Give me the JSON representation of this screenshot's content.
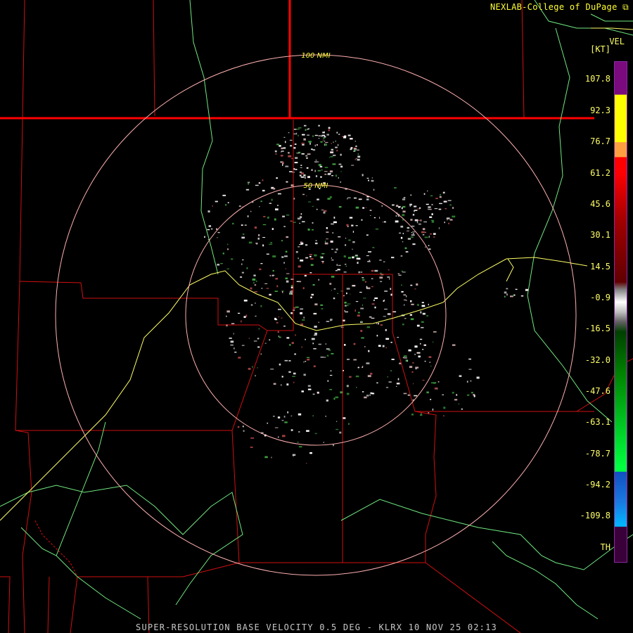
{
  "header": {
    "credit": "NEXLAB-College of DuPage",
    "credit_icon": "external-link-icon",
    "product_code": "VEL",
    "units": "[KT]"
  },
  "rings": [
    {
      "label": "100 NMI"
    },
    {
      "label": "50 NMI"
    }
  ],
  "legend": {
    "labels": [
      "107.8",
      "92.3",
      "76.7",
      "61.2",
      "45.6",
      "30.1",
      "14.5",
      "-0.9",
      "-16.5",
      "-32.0",
      "-47.6",
      "-63.1",
      "-78.7",
      "-94.2",
      "-109.8",
      "TH"
    ],
    "colors": {
      "purple": "#7a0a7e",
      "yellow": "#ffff00",
      "orange": "#ffa040",
      "red": "#ff0000",
      "dark_red": "#600000",
      "gray": "#c0c0c0",
      "dark_green": "#004000",
      "green": "#00ff40",
      "blue": "#1050c0",
      "cyan": "#00b8ff",
      "range_fold": "#3a003a"
    }
  },
  "map_colors": {
    "state_border": "#ff0000",
    "county_border": "#d01010",
    "highway": "#ffff66",
    "river": "#80ff90",
    "range_ring": "#ffb0b0"
  },
  "footer": {
    "text": "SUPER-RESOLUTION BASE VELOCITY 0.5 DEG - KLRX 10 NOV 25 02:13"
  }
}
